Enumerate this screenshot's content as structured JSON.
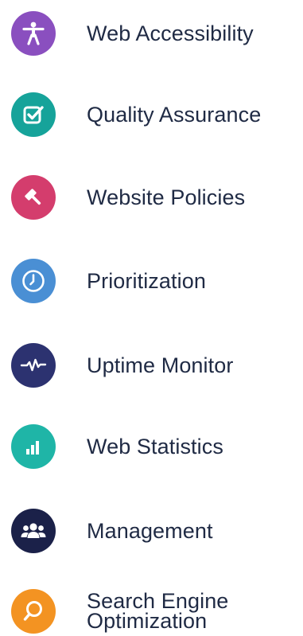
{
  "features": [
    {
      "id": "web-accessibility",
      "label": "Web Accessibility",
      "icon": "accessibility-person-icon",
      "color": "#8a4fbf"
    },
    {
      "id": "quality-assurance",
      "label": "Quality Assurance",
      "icon": "checkbox-check-icon",
      "color": "#16a39a"
    },
    {
      "id": "website-policies",
      "label": "Website Policies",
      "icon": "gavel-icon",
      "color": "#d43d6d"
    },
    {
      "id": "prioritization",
      "label": "Prioritization",
      "icon": "clock-icon",
      "color": "#4a8fd4"
    },
    {
      "id": "uptime-monitor",
      "label": "Uptime Monitor",
      "icon": "heartbeat-pulse-icon",
      "color": "#2c3270"
    },
    {
      "id": "web-statistics",
      "label": "Web Statistics",
      "icon": "bar-chart-icon",
      "color": "#1fb5a7"
    },
    {
      "id": "management",
      "label": "Management",
      "icon": "users-group-icon",
      "color": "#1b2149"
    },
    {
      "id": "search-engine-optimization",
      "label": "Search Engine Optimization",
      "icon": "magnifier-icon",
      "color": "#f39322"
    }
  ]
}
